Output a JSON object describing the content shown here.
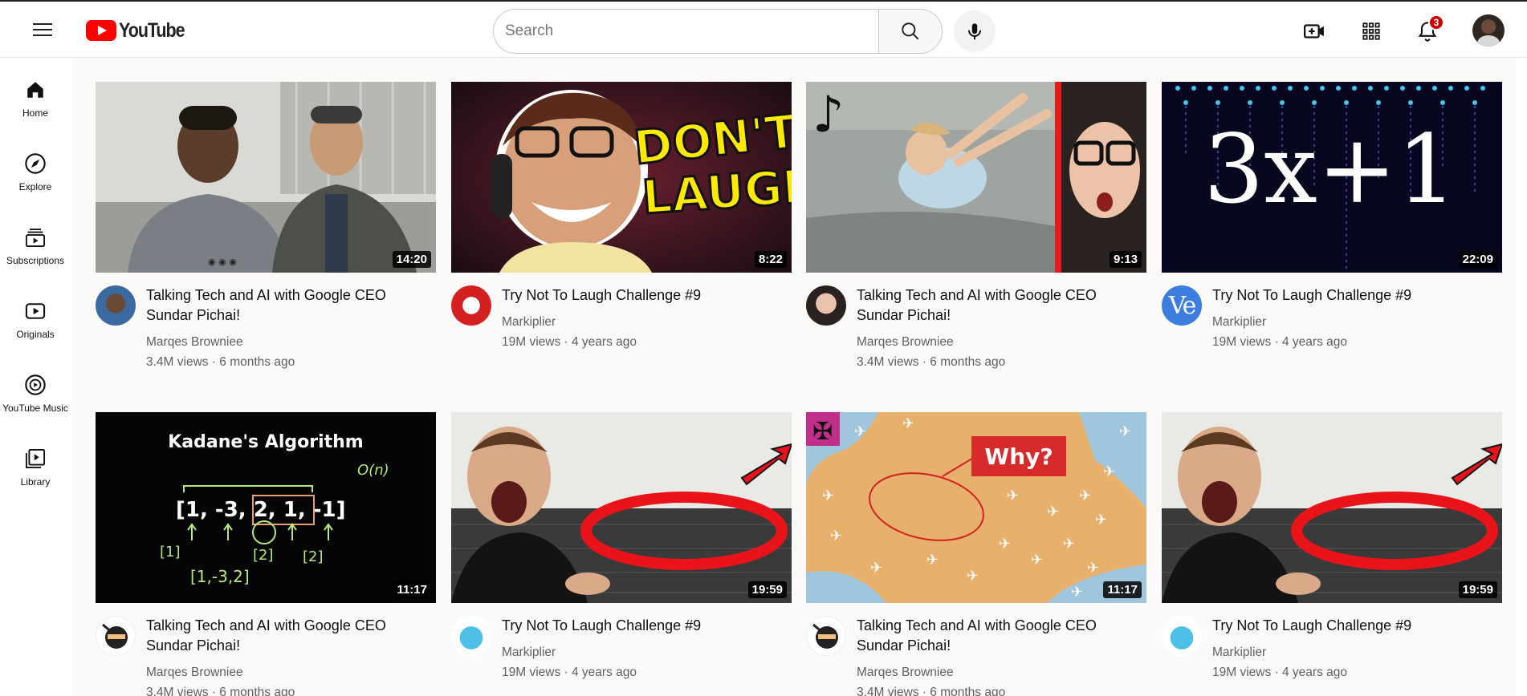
{
  "header": {
    "logo_text": "YouTube",
    "search_placeholder": "Search",
    "notification_count": "3"
  },
  "sidebar": {
    "items": [
      {
        "label": "Home",
        "icon": "home-icon"
      },
      {
        "label": "Explore",
        "icon": "compass-icon"
      },
      {
        "label": "Subscriptions",
        "icon": "subscriptions-icon"
      },
      {
        "label": "Originals",
        "icon": "originals-icon"
      },
      {
        "label": "YouTube Music",
        "icon": "music-icon"
      },
      {
        "label": "Library",
        "icon": "library-icon"
      }
    ]
  },
  "videos": [
    {
      "title": "Talking Tech and AI with Google CEO Sundar Pichai!",
      "channel": "Marqes Browniee",
      "stats": "3.4M views · 6 months ago",
      "duration": "14:20",
      "thumb": "interview"
    },
    {
      "title": "Try Not To Laugh Challenge #9",
      "channel": "Markiplier",
      "stats": "19M views · 4 years ago",
      "duration": "8:22",
      "thumb": "dont-laugh",
      "thumb_text_1": "DON'T",
      "thumb_text_2": "LAUGH"
    },
    {
      "title": "Talking Tech and AI with Google CEO Sundar Pichai!",
      "channel": "Marqes Browniee",
      "stats": "3.4M views · 6 months ago",
      "duration": "9:13",
      "thumb": "beach"
    },
    {
      "title": "Try Not To Laugh Challenge #9",
      "channel": "Markiplier",
      "stats": "19M views · 4 years ago",
      "duration": "22:09",
      "thumb": "collatz",
      "thumb_text_1": "3x+1",
      "avatar_text": "Ve"
    },
    {
      "title": "Talking Tech and AI with Google CEO Sundar Pichai!",
      "channel": "Marqes Browniee",
      "stats": "3.4M views · 6 months ago",
      "duration": "11:17",
      "thumb": "kadane",
      "thumb_text_1": "Kadane's Algorithm",
      "thumb_text_2": "[1, -3, 2, 1, -1]"
    },
    {
      "title": "Try Not To Laugh Challenge #9",
      "channel": "Markiplier",
      "stats": "19M views · 4 years ago",
      "duration": "19:59",
      "thumb": "mrbeast"
    },
    {
      "title": "Talking Tech and AI with Google CEO Sundar Pichai!",
      "channel": "Marqes Browniee",
      "stats": "3.4M views · 6 months ago",
      "duration": "11:17",
      "thumb": "map",
      "thumb_text_1": "Why?"
    },
    {
      "title": "Try Not To Laugh Challenge #9",
      "channel": "Markiplier",
      "stats": "19M views · 4 years ago",
      "duration": "19:59",
      "thumb": "mrbeast"
    }
  ]
}
